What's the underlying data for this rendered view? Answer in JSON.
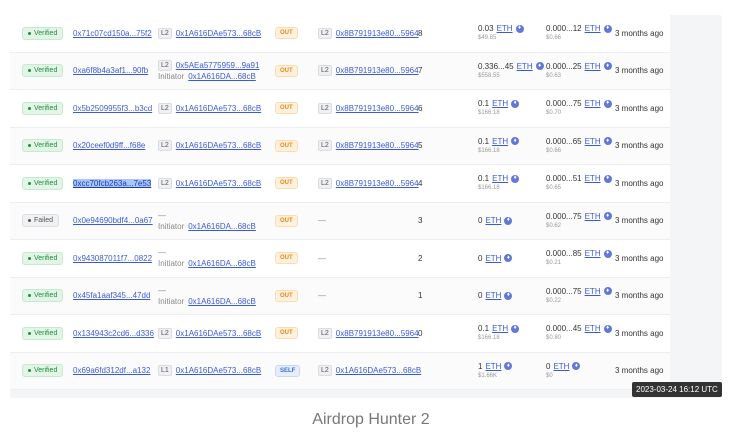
{
  "currency": "ETH",
  "tooltip": "2023-03-24 16:12 UTC",
  "caption": "Airdrop Hunter 2",
  "rows": [
    {
      "status": "Verified",
      "status_kind": "ok",
      "hash": "0x71c07cd150a...75f2",
      "selected": false,
      "from_tag": "L2",
      "from_addr": "0x1A616DAe573...68cB",
      "initiator_label": "",
      "initiator_addr": "",
      "direction": "OUT",
      "dir_kind": "out",
      "to_tag": "L2",
      "to_addr": "0x8B791913e80...5964",
      "nonce": "8",
      "value": "0.03",
      "value_usd": "$49.85",
      "fee": "0.000...12",
      "fee_usd": "$0.66",
      "age": "3 months ago"
    },
    {
      "status": "Verified",
      "status_kind": "ok",
      "hash": "0xa6f8b4a3af1...90fb",
      "selected": false,
      "from_tag": "L2",
      "from_addr": "0x5AEa5775959...9a91",
      "initiator_label": "Initiator",
      "initiator_addr": "0x1A616DA...68cB",
      "direction": "OUT",
      "dir_kind": "out",
      "to_tag": "L2",
      "to_addr": "0x8B791913e80...5964",
      "nonce": "7",
      "value": "0.336...45",
      "value_usd": "$558.55",
      "fee": "0.000...25",
      "fee_usd": "$0.63",
      "age": "3 months ago"
    },
    {
      "status": "Verified",
      "status_kind": "ok",
      "hash": "0x5b2509955f3...b3cd",
      "selected": false,
      "from_tag": "L2",
      "from_addr": "0x1A616DAe573...68cB",
      "initiator_label": "",
      "initiator_addr": "",
      "direction": "OUT",
      "dir_kind": "out",
      "to_tag": "L2",
      "to_addr": "0x8B791913e80...5964",
      "nonce": "6",
      "value": "0.1",
      "value_usd": "$166.18",
      "fee": "0.000...75",
      "fee_usd": "$0.70",
      "age": "3 months ago"
    },
    {
      "status": "Verified",
      "status_kind": "ok",
      "hash": "0x20ceef0d9ff...f68e",
      "selected": false,
      "from_tag": "L2",
      "from_addr": "0x1A616DAe573...68cB",
      "initiator_label": "",
      "initiator_addr": "",
      "direction": "OUT",
      "dir_kind": "out",
      "to_tag": "L2",
      "to_addr": "0x8B791913e80...5964",
      "nonce": "5",
      "value": "0.1",
      "value_usd": "$166.18",
      "fee": "0.000...65",
      "fee_usd": "$0.66",
      "age": "3 months ago"
    },
    {
      "status": "Verified",
      "status_kind": "ok",
      "hash": "0xcc70fcb263a...7e53",
      "selected": true,
      "from_tag": "L2",
      "from_addr": "0x1A616DAe573...68cB",
      "initiator_label": "",
      "initiator_addr": "",
      "direction": "OUT",
      "dir_kind": "out",
      "to_tag": "L2",
      "to_addr": "0x8B791913e80...5964",
      "nonce": "4",
      "value": "0.1",
      "value_usd": "$166.18",
      "fee": "0.000...51",
      "fee_usd": "$0.65",
      "age": "3 months ago"
    },
    {
      "status": "Failed",
      "status_kind": "fail",
      "hash": "0x0e94690bdf4...0a67",
      "selected": false,
      "from_tag": "",
      "from_addr": "—",
      "initiator_label": "Initiator",
      "initiator_addr": "0x1A616DA...68cB",
      "direction": "OUT",
      "dir_kind": "out",
      "to_tag": "",
      "to_addr": "—",
      "nonce": "3",
      "value": "0",
      "value_usd": "",
      "fee": "0.000...75",
      "fee_usd": "$0.62",
      "age": "3 months ago"
    },
    {
      "status": "Verified",
      "status_kind": "ok",
      "hash": "0x943087011f7...0822",
      "selected": false,
      "from_tag": "",
      "from_addr": "—",
      "initiator_label": "Initiator",
      "initiator_addr": "0x1A616DA...68cB",
      "direction": "OUT",
      "dir_kind": "out",
      "to_tag": "",
      "to_addr": "—",
      "nonce": "2",
      "value": "0",
      "value_usd": "",
      "fee": "0.000...85",
      "fee_usd": "$0.21",
      "age": "3 months ago"
    },
    {
      "status": "Verified",
      "status_kind": "ok",
      "hash": "0x45fa1aaf345...47dd",
      "selected": false,
      "from_tag": "",
      "from_addr": "—",
      "initiator_label": "Initiator",
      "initiator_addr": "0x1A616DA...68cB",
      "direction": "OUT",
      "dir_kind": "out",
      "to_tag": "",
      "to_addr": "—",
      "nonce": "1",
      "value": "0",
      "value_usd": "",
      "fee": "0.000...75",
      "fee_usd": "$0.22",
      "age": "3 months ago"
    },
    {
      "status": "Verified",
      "status_kind": "ok",
      "hash": "0x134943c2cd6...d336",
      "selected": false,
      "from_tag": "L2",
      "from_addr": "0x1A616DAe573...68cB",
      "initiator_label": "",
      "initiator_addr": "",
      "direction": "OUT",
      "dir_kind": "out",
      "to_tag": "L2",
      "to_addr": "0x8B791913e80...5964",
      "nonce": "0",
      "value": "0.1",
      "value_usd": "$166.18",
      "fee": "0.000...45",
      "fee_usd": "$0.80",
      "age": "3 months ago"
    },
    {
      "status": "Verified",
      "status_kind": "ok",
      "hash": "0x69a6fd312df...a132",
      "selected": false,
      "from_tag": "L1",
      "from_addr": "0x1A616DAe573...68cB",
      "initiator_label": "",
      "initiator_addr": "",
      "direction": "SELF",
      "dir_kind": "self",
      "to_tag": "L2",
      "to_addr": "0x1A616DAe573...68cB",
      "nonce": "",
      "value": "1",
      "value_usd": "$1.66K",
      "fee": "0",
      "fee_usd": "$0",
      "age": "3 months ago"
    }
  ]
}
